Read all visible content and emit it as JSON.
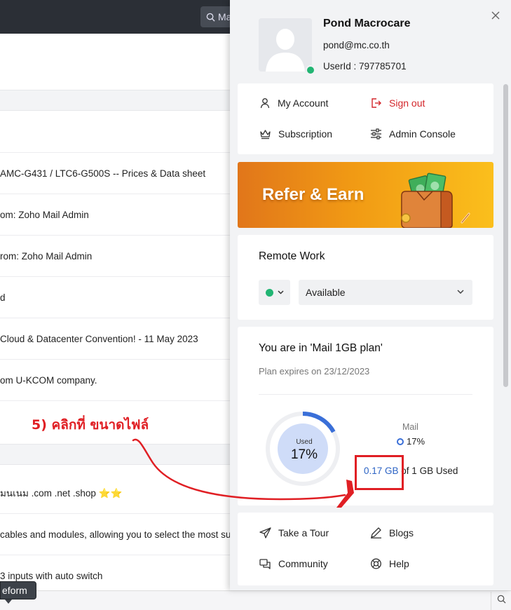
{
  "background": {
    "search_label": "Ma",
    "rows": [
      "AMC-G431 / LTC6-G500S -- Prices & Data sheet",
      "om: Zoho Mail Admin",
      "rom: Zoho Mail Admin",
      "d",
      "Cloud & Datacenter Convention! -  11 May 2023",
      "om U-KCOM company.",
      "มนเนม .com .net .shop ⭐⭐",
      "cables and modules, allowing you to select the most su",
      "3 inputs with auto switch"
    ],
    "tooltip": "eform"
  },
  "profile": {
    "name": "Pond Macrocare",
    "email": "pond@mc.co.th",
    "user_id": "UserId : 797785701"
  },
  "account_menu": {
    "my_account": "My Account",
    "sign_out": "Sign out",
    "subscription": "Subscription",
    "admin_console": "Admin Console"
  },
  "banner": {
    "text": "Refer & Earn"
  },
  "remote_work": {
    "title": "Remote Work",
    "status": "Available"
  },
  "plan": {
    "title": "You are in 'Mail 1GB plan'",
    "expiry": "Plan expires on 23/12/2023",
    "donut_label": "Used",
    "donut_pct": "17%",
    "used_fraction": 0.17,
    "legend_title": "Mail",
    "legend_value": "17%",
    "usage_amount": "0.17 GB",
    "usage_suffix": "of 1 GB Used"
  },
  "links": {
    "take_tour": "Take a Tour",
    "blogs": "Blogs",
    "community": "Community",
    "help": "Help"
  },
  "annotation": {
    "text": "5) คลิกที่ ขนาดไฟล์"
  },
  "colors": {
    "accent_blue": "#2c63c4",
    "sign_out_red": "#d3262b",
    "status_green": "#22b573",
    "annotation_red": "#e01f24"
  }
}
